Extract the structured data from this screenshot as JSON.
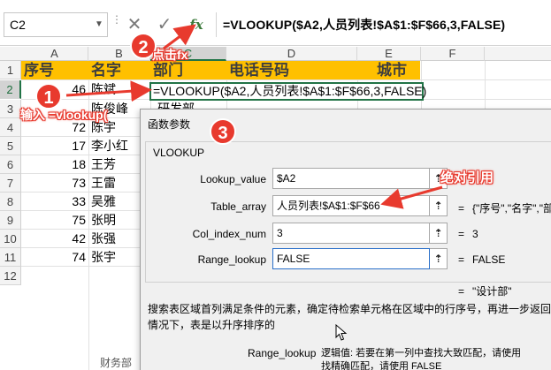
{
  "formula_bar": {
    "name_box": "C2",
    "cancel_icon": "cancel-x",
    "enter_icon": "check-mark",
    "fx_label": "fx",
    "formula": "=VLOOKUP($A2,人员列表!$A$1:$F$66,3,FALSE)"
  },
  "grid": {
    "columns": [
      "A",
      "B",
      "C",
      "D",
      "E",
      "F"
    ],
    "selected_column": "C",
    "rows": [
      "1",
      "2",
      "3",
      "4",
      "5",
      "6",
      "7",
      "8",
      "9",
      "10",
      "11",
      "12"
    ],
    "selected_row": "2",
    "header_cells": [
      "序号",
      "名字",
      "部门",
      "电话号码",
      "城市"
    ],
    "data_rows": [
      {
        "num": "46",
        "name": "陈斌",
        "dept": ""
      },
      {
        "num": "",
        "name": "陈俊峰",
        "dept": "研发部"
      },
      {
        "num": "72",
        "name": "陈宇",
        "dept": ""
      },
      {
        "num": "17",
        "name": "李小红",
        "dept": ""
      },
      {
        "num": "18",
        "name": "王芳",
        "dept": ""
      },
      {
        "num": "73",
        "name": "王雷",
        "dept": ""
      },
      {
        "num": "33",
        "name": "吴雅",
        "dept": ""
      },
      {
        "num": "75",
        "name": "张明",
        "dept": ""
      },
      {
        "num": "42",
        "name": "张强",
        "dept": ""
      },
      {
        "num": "74",
        "name": "张宇",
        "dept": ""
      }
    ],
    "partial_bottom_cell": "财务部",
    "active_cell_formula": "=VLOOKUP($A2,人员列表!$A$1:$F$66,3,FALSE)",
    "header_fill": "#ffc000"
  },
  "dialog": {
    "title": "函数参数",
    "function_name": "VLOOKUP",
    "args": [
      {
        "label": "Lookup_value",
        "value": "$A2",
        "result": "\"设计部\""
      },
      {
        "label": "Table_array",
        "value": "人员列表!$A$1:$F$66",
        "result": "{\"序号\",\"名字\",\"部"
      },
      {
        "label": "Col_index_num",
        "value": "3",
        "result": "3"
      },
      {
        "label": "Range_lookup",
        "value": "FALSE",
        "result": "FALSE"
      }
    ],
    "equals_sign": "=",
    "collapse_button_glyph": "⇡",
    "function_result": "\"设计部\"",
    "description_line1": "搜索表区域首列满足条件的元素，确定待检索单元格在区域中的行序号，再进一步返回选",
    "description_line2": "情况下，表是以升序排序的",
    "param_name": "Range_lookup",
    "param_desc_line1": "逻辑值: 若要在第一列中查找大致匹配，请使用",
    "param_desc_line2": "找精确匹配，请使用 FALSE"
  },
  "annotations": {
    "step1_number": "1",
    "step1_text": "输入 =vlookup(",
    "step2_number": "2",
    "step2_text": "点击fx",
    "step3_number": "3",
    "absolute_ref_text": "绝对引用",
    "accent_color": "#e83a2e"
  }
}
